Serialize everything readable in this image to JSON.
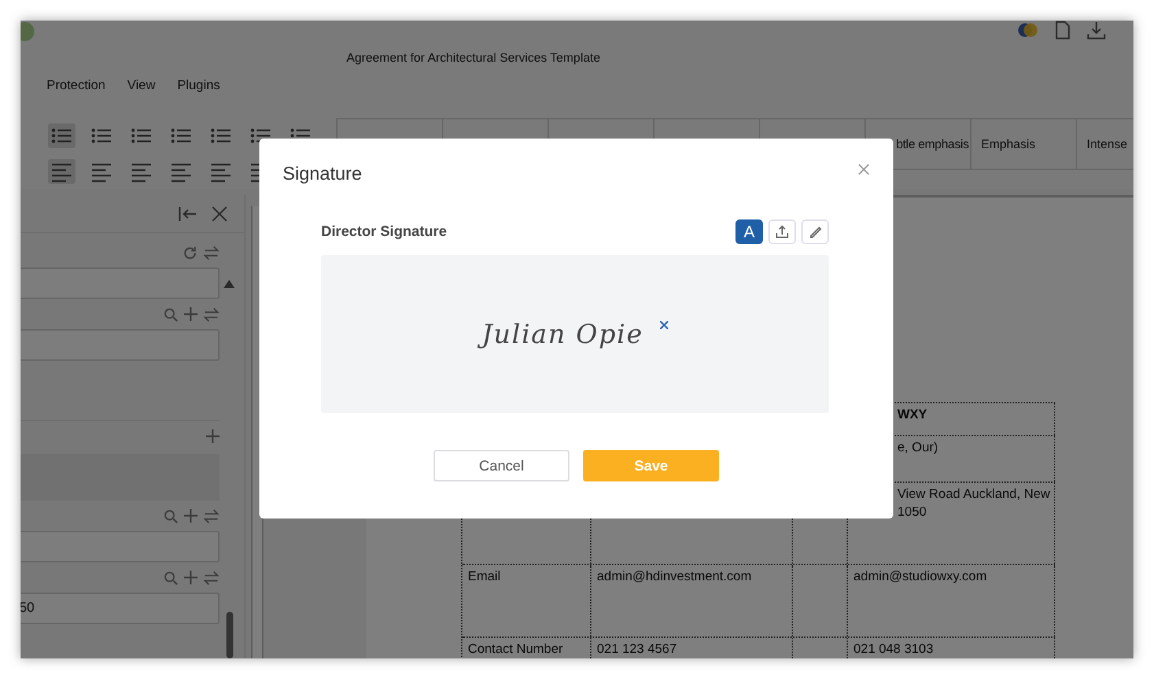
{
  "window": {
    "title": "Agreement for Architectural Services Template"
  },
  "menu": [
    {
      "label": "Protection"
    },
    {
      "label": "View"
    },
    {
      "label": "Plugins"
    }
  ],
  "styles": [
    {
      "label": "btle emphasis",
      "kind": "cut"
    },
    {
      "label": "Emphasis",
      "kind": "plain"
    },
    {
      "label": "Intense",
      "kind": "plain"
    }
  ],
  "sidebar": {
    "field_value": "50"
  },
  "table": {
    "rows": [
      {
        "column_4": "WXY",
        "heading": true
      },
      {
        "column_4": "e, Our)",
        "heading": false
      },
      {
        "column_4": "View Road Auckland, New\n1050",
        "heading": false
      },
      {
        "column_1": "Email",
        "column_2": "admin@hdinvestment.com",
        "column_4": "admin@studiowxy.com",
        "heading": false
      },
      {
        "column_1": "Contact Number",
        "column_2": "021 123 4567",
        "column_4": "021 048 3103",
        "heading": false
      }
    ]
  },
  "dialog": {
    "title": "Signature",
    "field_label": "Director Signature",
    "modes": [
      {
        "kind": "type",
        "label": "A",
        "selected": true
      },
      {
        "kind": "upload",
        "selected": false
      },
      {
        "kind": "draw",
        "selected": false
      }
    ],
    "signature": "Julian Opie",
    "buttons": [
      {
        "label": "Cancel",
        "kind": "secondary"
      },
      {
        "label": "Save",
        "kind": "primary"
      }
    ]
  }
}
